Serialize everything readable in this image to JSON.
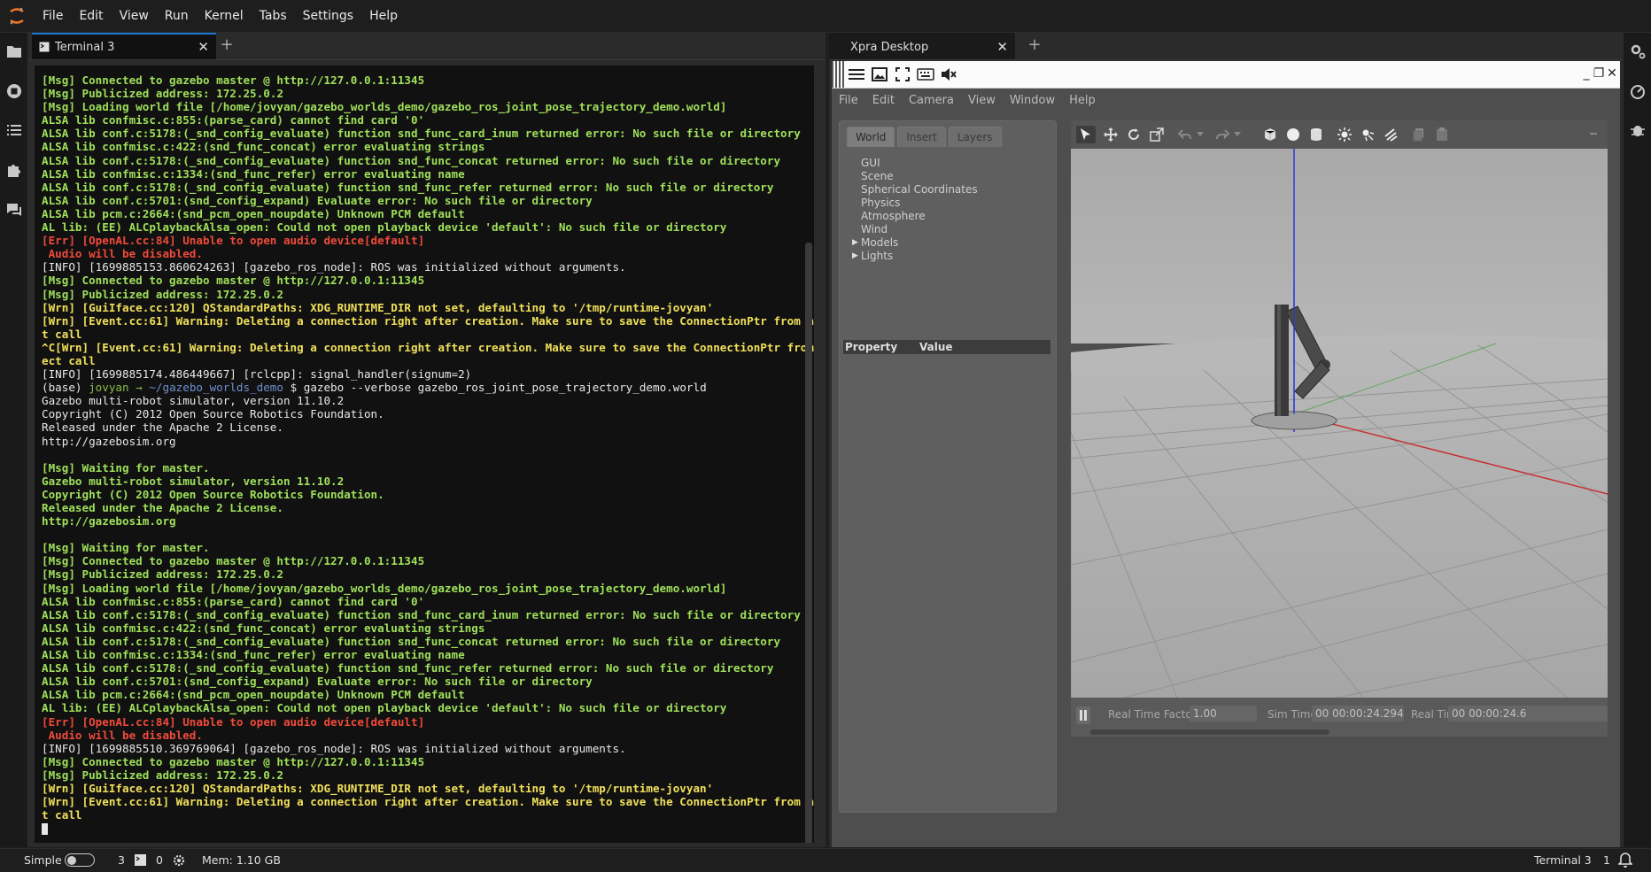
{
  "menubar": {
    "items": [
      "File",
      "Edit",
      "View",
      "Run",
      "Kernel",
      "Tabs",
      "Settings",
      "Help"
    ]
  },
  "left_tab": {
    "title": "Terminal 3"
  },
  "right_tab": {
    "title": "Xpra Desktop"
  },
  "terminal": {
    "lines": [
      {
        "c": "g",
        "t": "[Msg] Connected to gazebo master @ http://127.0.0.1:11345"
      },
      {
        "c": "g",
        "t": "[Msg] Publicized address: 172.25.0.2"
      },
      {
        "c": "g",
        "t": "[Msg] Loading world file [/home/jovyan/gazebo_worlds_demo/gazebo_ros_joint_pose_trajectory_demo.world]"
      },
      {
        "c": "g",
        "t": "ALSA lib confmisc.c:855:(parse_card) cannot find card '0'"
      },
      {
        "c": "g",
        "t": "ALSA lib conf.c:5178:(_snd_config_evaluate) function snd_func_card_inum returned error: No such file or directory"
      },
      {
        "c": "g",
        "t": "ALSA lib confmisc.c:422:(snd_func_concat) error evaluating strings"
      },
      {
        "c": "g",
        "t": "ALSA lib conf.c:5178:(_snd_config_evaluate) function snd_func_concat returned error: No such file or directory"
      },
      {
        "c": "g",
        "t": "ALSA lib confmisc.c:1334:(snd_func_refer) error evaluating name"
      },
      {
        "c": "g",
        "t": "ALSA lib conf.c:5178:(_snd_config_evaluate) function snd_func_refer returned error: No such file or directory"
      },
      {
        "c": "g",
        "t": "ALSA lib conf.c:5701:(snd_config_expand) Evaluate error: No such file or directory"
      },
      {
        "c": "g",
        "t": "ALSA lib pcm.c:2664:(snd_pcm_open_noupdate) Unknown PCM default"
      },
      {
        "c": "g",
        "t": "AL lib: (EE) ALCplaybackAlsa_open: Could not open playback device 'default': No such file or directory"
      },
      {
        "c": "r",
        "t": "[Err] [OpenAL.cc:84] Unable to open audio device[default]"
      },
      {
        "c": "r",
        "t": " Audio will be disabled."
      },
      {
        "c": "w",
        "t": "[INFO] [1699885153.860624263] [gazebo_ros_node]: ROS was initialized without arguments."
      },
      {
        "c": "g",
        "t": "[Msg] Connected to gazebo master @ http://127.0.0.1:11345"
      },
      {
        "c": "g",
        "t": "[Msg] Publicized address: 172.25.0.2"
      },
      {
        "c": "y",
        "t": "[Wrn] [GuiIface.cc:120] QStandardPaths: XDG_RUNTIME_DIR not set, defaulting to '/tmp/runtime-jovyan'"
      },
      {
        "c": "y",
        "t": "[Wrn] [Event.cc:61] Warning: Deleting a connection right after creation. Make sure to save the ConnectionPtr from a Connec"
      },
      {
        "c": "y",
        "t": "t call"
      },
      {
        "c": "y",
        "t": "^C[Wrn] [Event.cc:61] Warning: Deleting a connection right after creation. Make sure to save the ConnectionPtr from a Conn"
      },
      {
        "c": "y",
        "t": "ect call"
      },
      {
        "c": "w",
        "t": "[INFO] [1699885174.486449667] [rclcpp]: signal_handler(signum=2)"
      },
      {
        "c": "prompt",
        "base": "(base) ",
        "user": "jovyan",
        "arrow": " → ",
        "dir": "~/gazebo_worlds_demo",
        "rest": " $ gazebo --verbose gazebo_ros_joint_pose_trajectory_demo.world"
      },
      {
        "c": "w",
        "t": "Gazebo multi-robot simulator, version 11.10.2"
      },
      {
        "c": "w",
        "t": "Copyright (C) 2012 Open Source Robotics Foundation."
      },
      {
        "c": "w",
        "t": "Released under the Apache 2 License."
      },
      {
        "c": "w",
        "t": "http://gazebosim.org"
      },
      {
        "c": "w",
        "t": ""
      },
      {
        "c": "g",
        "t": "[Msg] Waiting for master."
      },
      {
        "c": "g",
        "t": "Gazebo multi-robot simulator, version 11.10.2"
      },
      {
        "c": "g",
        "t": "Copyright (C) 2012 Open Source Robotics Foundation."
      },
      {
        "c": "g",
        "t": "Released under the Apache 2 License."
      },
      {
        "c": "g",
        "t": "http://gazebosim.org"
      },
      {
        "c": "w",
        "t": ""
      },
      {
        "c": "g",
        "t": "[Msg] Waiting for master."
      },
      {
        "c": "g",
        "t": "[Msg] Connected to gazebo master @ http://127.0.0.1:11345"
      },
      {
        "c": "g",
        "t": "[Msg] Publicized address: 172.25.0.2"
      },
      {
        "c": "g",
        "t": "[Msg] Loading world file [/home/jovyan/gazebo_worlds_demo/gazebo_ros_joint_pose_trajectory_demo.world]"
      },
      {
        "c": "g",
        "t": "ALSA lib confmisc.c:855:(parse_card) cannot find card '0'"
      },
      {
        "c": "g",
        "t": "ALSA lib conf.c:5178:(_snd_config_evaluate) function snd_func_card_inum returned error: No such file or directory"
      },
      {
        "c": "g",
        "t": "ALSA lib confmisc.c:422:(snd_func_concat) error evaluating strings"
      },
      {
        "c": "g",
        "t": "ALSA lib conf.c:5178:(_snd_config_evaluate) function snd_func_concat returned error: No such file or directory"
      },
      {
        "c": "g",
        "t": "ALSA lib confmisc.c:1334:(snd_func_refer) error evaluating name"
      },
      {
        "c": "g",
        "t": "ALSA lib conf.c:5178:(_snd_config_evaluate) function snd_func_refer returned error: No such file or directory"
      },
      {
        "c": "g",
        "t": "ALSA lib conf.c:5701:(snd_config_expand) Evaluate error: No such file or directory"
      },
      {
        "c": "g",
        "t": "ALSA lib pcm.c:2664:(snd_pcm_open_noupdate) Unknown PCM default"
      },
      {
        "c": "g",
        "t": "AL lib: (EE) ALCplaybackAlsa_open: Could not open playback device 'default': No such file or directory"
      },
      {
        "c": "r",
        "t": "[Err] [OpenAL.cc:84] Unable to open audio device[default]"
      },
      {
        "c": "r",
        "t": " Audio will be disabled."
      },
      {
        "c": "w",
        "t": "[INFO] [1699885510.369769064] [gazebo_ros_node]: ROS was initialized without arguments."
      },
      {
        "c": "g",
        "t": "[Msg] Connected to gazebo master @ http://127.0.0.1:11345"
      },
      {
        "c": "g",
        "t": "[Msg] Publicized address: 172.25.0.2"
      },
      {
        "c": "y",
        "t": "[Wrn] [GuiIface.cc:120] QStandardPaths: XDG_RUNTIME_DIR not set, defaulting to '/tmp/runtime-jovyan'"
      },
      {
        "c": "y",
        "t": "[Wrn] [Event.cc:61] Warning: Deleting a connection right after creation. Make sure to save the ConnectionPtr from a Connec"
      },
      {
        "c": "y",
        "t": "t call"
      },
      {
        "c": "cursor",
        "t": ""
      }
    ]
  },
  "gazebo": {
    "menu": [
      "File",
      "Edit",
      "Camera",
      "View",
      "Window",
      "Help"
    ],
    "tabs": [
      "World",
      "Insert",
      "Layers"
    ],
    "tree": [
      {
        "label": "GUI",
        "expandable": false
      },
      {
        "label": "Scene",
        "expandable": false
      },
      {
        "label": "Spherical Coordinates",
        "expandable": false
      },
      {
        "label": "Physics",
        "expandable": false
      },
      {
        "label": "Atmosphere",
        "expandable": false
      },
      {
        "label": "Wind",
        "expandable": false
      },
      {
        "label": "Models",
        "expandable": true
      },
      {
        "label": "Lights",
        "expandable": true
      }
    ],
    "property_header": {
      "property": "Property",
      "value": "Value"
    },
    "bottom": {
      "rtf_label": "Real Time Factor:",
      "rtf_value": "1.00",
      "sim_label": "Sim Time:",
      "sim_value": "00 00:00:24.294",
      "real_label": "Real Time:",
      "real_value": "00 00:00:24.6"
    }
  },
  "statusbar": {
    "mode_label": "Simple",
    "terminals_count": "3",
    "kernels_count": "0",
    "memory": "Mem: 1.10 GB",
    "active": "Terminal 3",
    "notifications": "1"
  },
  "colors": {
    "accent": "#1976d2",
    "term_green": "#9fe05a",
    "term_yellow": "#f0e05a",
    "term_red": "#f04a3a"
  }
}
